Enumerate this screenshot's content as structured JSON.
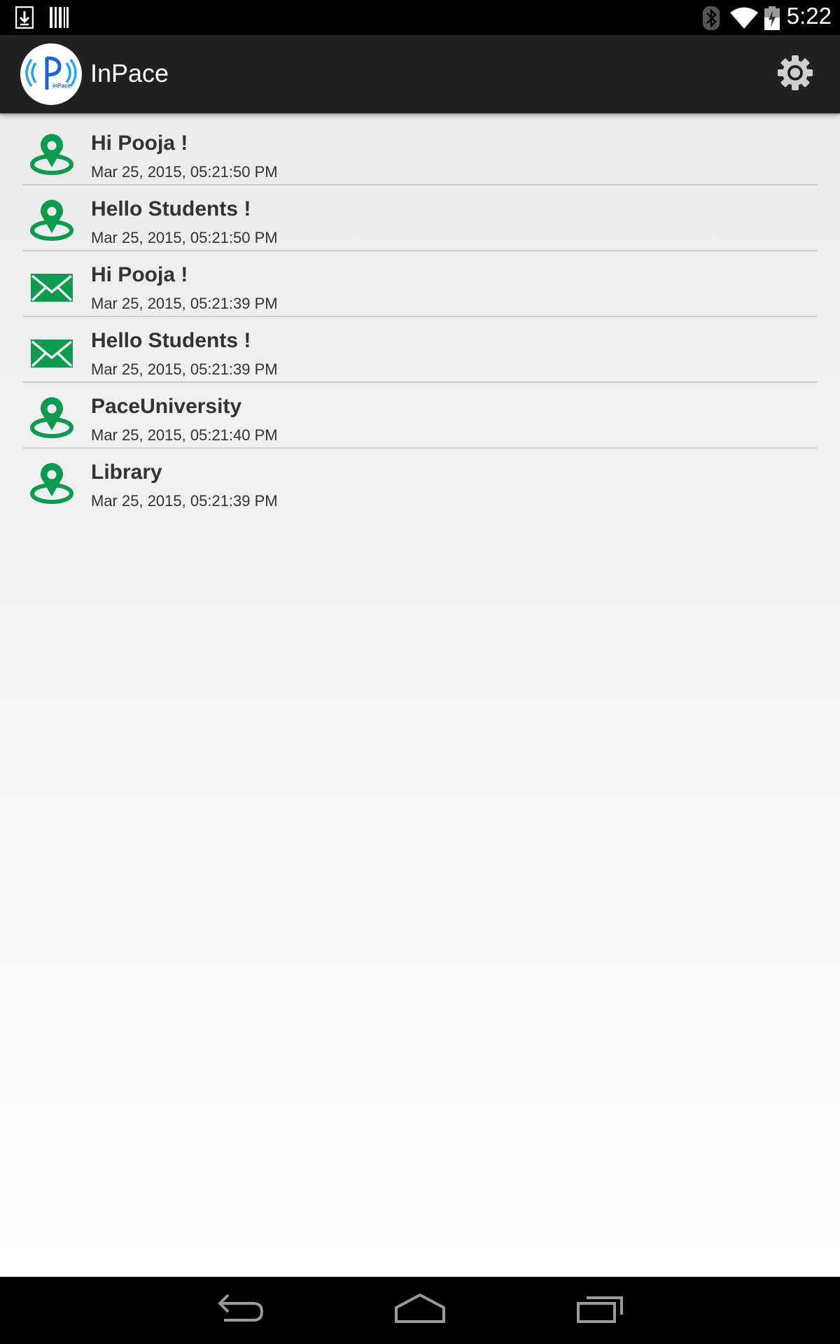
{
  "status_bar": {
    "time": "5:22",
    "icons": [
      "download-icon",
      "barcode-icon",
      "bluetooth-icon",
      "wifi-icon",
      "battery-icon"
    ]
  },
  "action_bar": {
    "title": "InPace",
    "logo_text": "inPace",
    "settings_icon": "gear-icon"
  },
  "messages": [
    {
      "title": "Hi Pooja !",
      "time": "Mar 25, 2015, 05:21:50 PM",
      "icon": "location-pin-icon"
    },
    {
      "title": "Hello Students !",
      "time": "Mar 25, 2015, 05:21:50 PM",
      "icon": "location-pin-icon"
    },
    {
      "title": "Hi Pooja !",
      "time": "Mar 25, 2015, 05:21:39 PM",
      "icon": "envelope-icon"
    },
    {
      "title": "Hello Students !",
      "time": "Mar 25, 2015, 05:21:39 PM",
      "icon": "envelope-icon"
    },
    {
      "title": "PaceUniversity",
      "time": "Mar 25, 2015, 05:21:40 PM",
      "icon": "location-pin-icon"
    },
    {
      "title": "Library",
      "time": "Mar 25, 2015, 05:21:39 PM",
      "icon": "location-pin-icon"
    }
  ],
  "nav_bar": {
    "buttons": [
      "back-icon",
      "home-icon",
      "recents-icon"
    ]
  },
  "colors": {
    "accent_green": "#0b9b4e",
    "logo_blue": "#1e63d6",
    "action_bar": "#212121",
    "text": "#333333"
  }
}
